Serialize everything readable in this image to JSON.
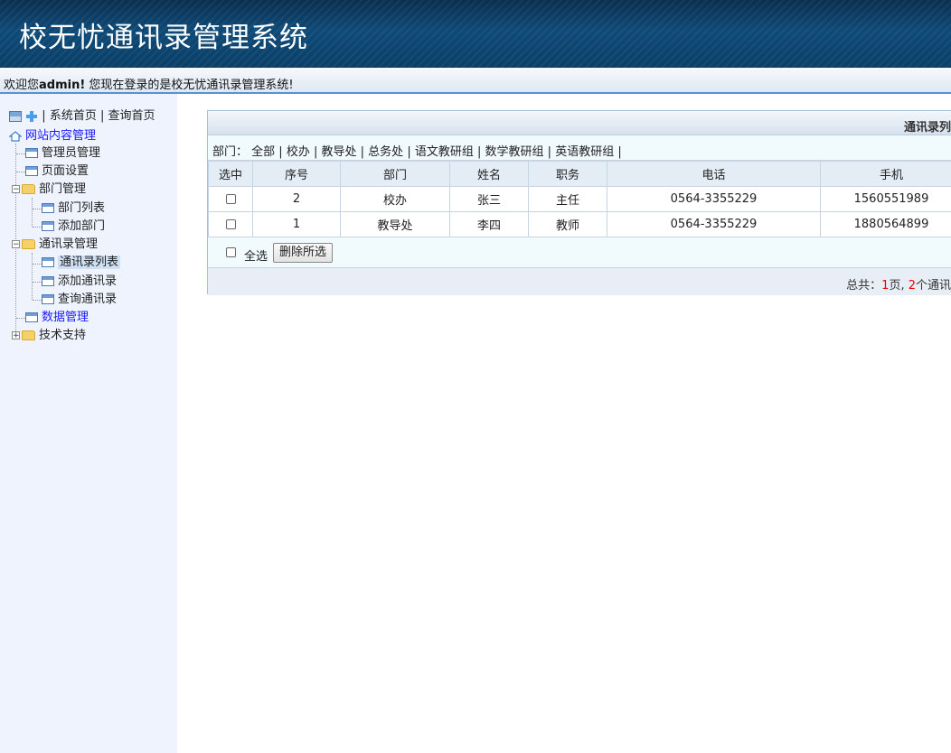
{
  "header": {
    "title": "校无忧通讯录管理系统"
  },
  "welcome": {
    "prefix": "欢迎您",
    "user": "admin!",
    "suffix": " 您现在登录的是校无忧通讯录管理系统!"
  },
  "sidebar": {
    "top_links": {
      "home": "系统首页",
      "sep": "|",
      "query": "查询首页"
    },
    "root": "网站内容管理",
    "items": {
      "admin": "管理员管理",
      "page_settings": "页面设置",
      "dept": "部门管理",
      "dept_list": "部门列表",
      "dept_add": "添加部门",
      "contacts": "通讯录管理",
      "contacts_list": "通讯录列表",
      "contacts_add": "添加通讯录",
      "contacts_query": "查询通讯录",
      "data": "数据管理",
      "support": "技术支持"
    }
  },
  "panel": {
    "title": "通讯录列",
    "filter_label": "部门：",
    "departments": [
      "全部",
      "校办",
      "教导处",
      "总务处",
      "语文教研组",
      "数学教研组",
      "英语教研组"
    ],
    "columns": [
      "选中",
      "序号",
      "部门",
      "姓名",
      "职务",
      "电话",
      "手机"
    ],
    "rows": [
      {
        "id": "2",
        "dept": "校办",
        "name": "张三",
        "position": "主任",
        "phone": "0564-3355229",
        "mobile": "1560551989"
      },
      {
        "id": "1",
        "dept": "教导处",
        "name": "李四",
        "position": "教师",
        "phone": "0564-3355229",
        "mobile": "1880564899"
      }
    ],
    "select_all": "全选",
    "delete_selected": "删除所选",
    "footer": {
      "total_prefix": "总共：",
      "pages": "1",
      "pages_unit": "页, ",
      "count": "2",
      "count_unit": "个通讯"
    }
  }
}
